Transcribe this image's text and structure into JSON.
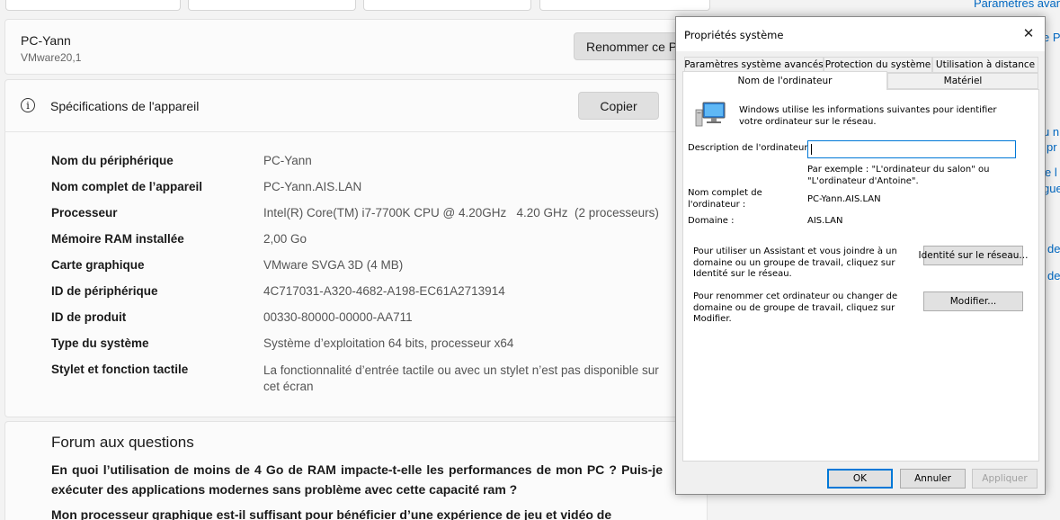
{
  "settings": {
    "device": {
      "name": "PC-Yann",
      "model": "VMware20,1",
      "rename_button": "Renommer ce PC"
    },
    "specs": {
      "header_title": "Spécifications de l'appareil",
      "copy_button": "Copier",
      "rows": [
        {
          "label": "Nom du périphérique",
          "value": "PC-Yann"
        },
        {
          "label": "Nom complet de l’appareil",
          "value": "PC-Yann.AIS.LAN"
        },
        {
          "label": "Processeur",
          "value": "Intel(R) Core(TM) i7-7700K CPU @ 4.20GHz   4.20 GHz  (2 processeurs)"
        },
        {
          "label": "Mémoire RAM installée",
          "value": "2,00 Go"
        },
        {
          "label": "Carte graphique",
          "value": "VMware SVGA 3D (4 MB)"
        },
        {
          "label": "ID de périphérique",
          "value": "4C717031-A320-4682-A198-EC61A2713914"
        },
        {
          "label": "ID de produit",
          "value": "00330-80000-00000-AA711"
        },
        {
          "label": "Type du système",
          "value": "Système d’exploitation 64 bits, processeur x64"
        },
        {
          "label": "Stylet et fonction tactile",
          "value": "La fonctionnalité d’entrée tactile ou avec un stylet n’est pas disponible sur cet écran"
        }
      ]
    },
    "faq": {
      "title": "Forum aux questions",
      "questions": [
        "En quoi l’utilisation de moins de 4 Go de RAM impacte-t-elle les performances de mon PC ? Puis-je exécuter des applications modernes sans problème avec cette capacité ram ?",
        "Mon processeur graphique est-il suffisant pour bénéficier d’une expérience de jeu et vidéo de"
      ]
    },
    "right_links": [
      "Paramètres avan",
      "e P",
      "u n",
      "pr",
      "e l",
      "gue",
      "de",
      "de"
    ]
  },
  "dialog": {
    "title": "Propriétés système",
    "tabs_row1": [
      "Paramètres système avancés",
      "Protection du système",
      "Utilisation à distance"
    ],
    "tabs_row2": [
      "Nom de l'ordinateur",
      "Matériel"
    ],
    "intro": "Windows utilise les informations suivantes pour identifier votre ordinateur sur le réseau.",
    "description_label": "Description de l'ordinateur :",
    "description_value": "",
    "example": "Par exemple : \"L'ordinateur du salon\" ou \"L'ordinateur d'Antoine\".",
    "fullname_label": "Nom complet de l'ordinateur :",
    "fullname_value": "PC-Yann.AIS.LAN",
    "domain_label": "Domaine :",
    "domain_value": "AIS.LAN",
    "assistant_text": "Pour utiliser un Assistant et vous joindre à un domaine ou un groupe de travail, cliquez sur Identité sur le réseau.",
    "network_id_button": "Identité sur le réseau...",
    "rename_text": "Pour renommer cet ordinateur ou changer de domaine ou de groupe de travail, cliquez sur Modifier.",
    "modify_button": "Modifier...",
    "ok_button": "OK",
    "cancel_button": "Annuler",
    "apply_button": "Appliquer",
    "accent_color": "#0078d7"
  }
}
